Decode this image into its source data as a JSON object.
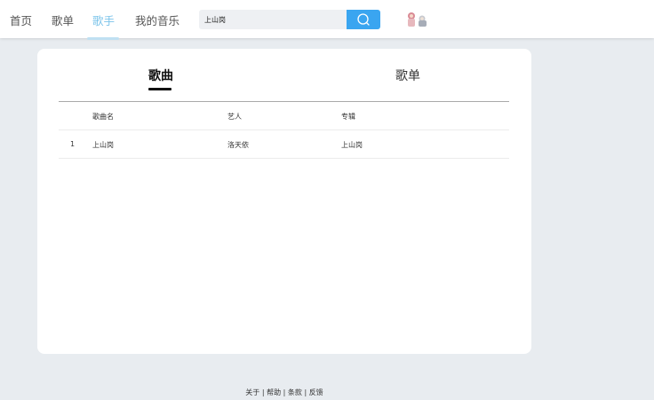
{
  "nav": {
    "items": [
      {
        "label": "首页"
      },
      {
        "label": "歌单"
      },
      {
        "label": "歌手"
      },
      {
        "label": "我的音乐"
      }
    ],
    "active_index": 2
  },
  "search": {
    "value": "上山岗",
    "button_icon": "search-icon"
  },
  "user": {
    "avatar_icon": "avatar-image"
  },
  "tabs": [
    {
      "label": "歌曲"
    },
    {
      "label": "歌单"
    }
  ],
  "active_tab": 0,
  "table": {
    "columns": [
      "歌曲名",
      "艺人",
      "专辑"
    ],
    "rows": [
      {
        "index": "1",
        "name": "上山岗",
        "artist": "洛天依",
        "album": "上山岗"
      }
    ]
  },
  "footer": {
    "links": [
      "关于",
      "帮助",
      "条款",
      "反馈"
    ],
    "separator": "|"
  },
  "colors": {
    "accent": "#3aa5f0",
    "nav_active": "#7cc4ea",
    "background": "#e8ecf0"
  }
}
